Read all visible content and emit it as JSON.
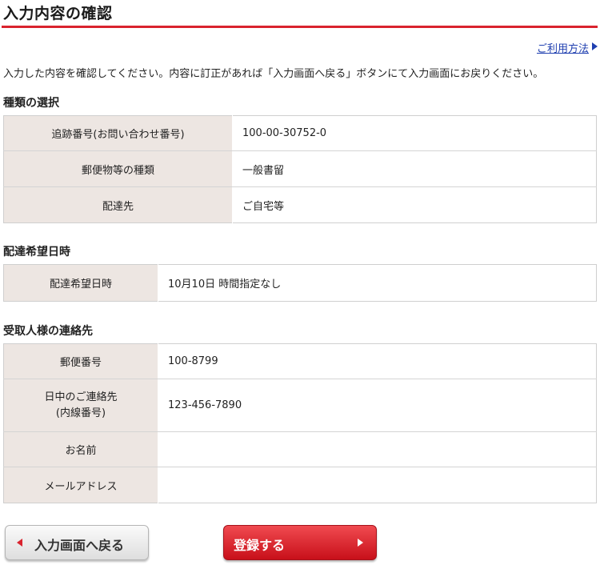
{
  "page": {
    "title": "入力内容の確認",
    "usage_link": "ご利用方法",
    "intro": "入力した内容を確認してください。内容に訂正があれば「入力画面へ戻る」ボタンにて入力画面にお戻りください。"
  },
  "sections": {
    "type_selection": {
      "heading": "種類の選択",
      "rows": [
        {
          "label": "追跡番号(お問い合わせ番号)",
          "value": "100-00-30752-0"
        },
        {
          "label": "郵便物等の種類",
          "value": "一般書留"
        },
        {
          "label": "配達先",
          "value": "ご自宅等"
        }
      ]
    },
    "delivery_date": {
      "heading": "配達希望日時",
      "rows": [
        {
          "label": "配達希望日時",
          "value": "10月10日 時間指定なし"
        }
      ]
    },
    "recipient_contact": {
      "heading": "受取人様の連絡先",
      "rows": [
        {
          "label": "郵便番号",
          "value": "100-8799"
        },
        {
          "label_line1": "日中のご連絡先",
          "label_line2": "(内線番号)",
          "value": "123-456-7890"
        },
        {
          "label": "お名前",
          "value": ""
        },
        {
          "label": "メールアドレス",
          "value": ""
        }
      ]
    }
  },
  "buttons": {
    "back_label": "入力画面へ戻る",
    "register_label": "登録する"
  },
  "colors": {
    "accent_red": "#d9232e",
    "label_bg": "#ede6e2",
    "link_blue": "#1f3fb0"
  }
}
